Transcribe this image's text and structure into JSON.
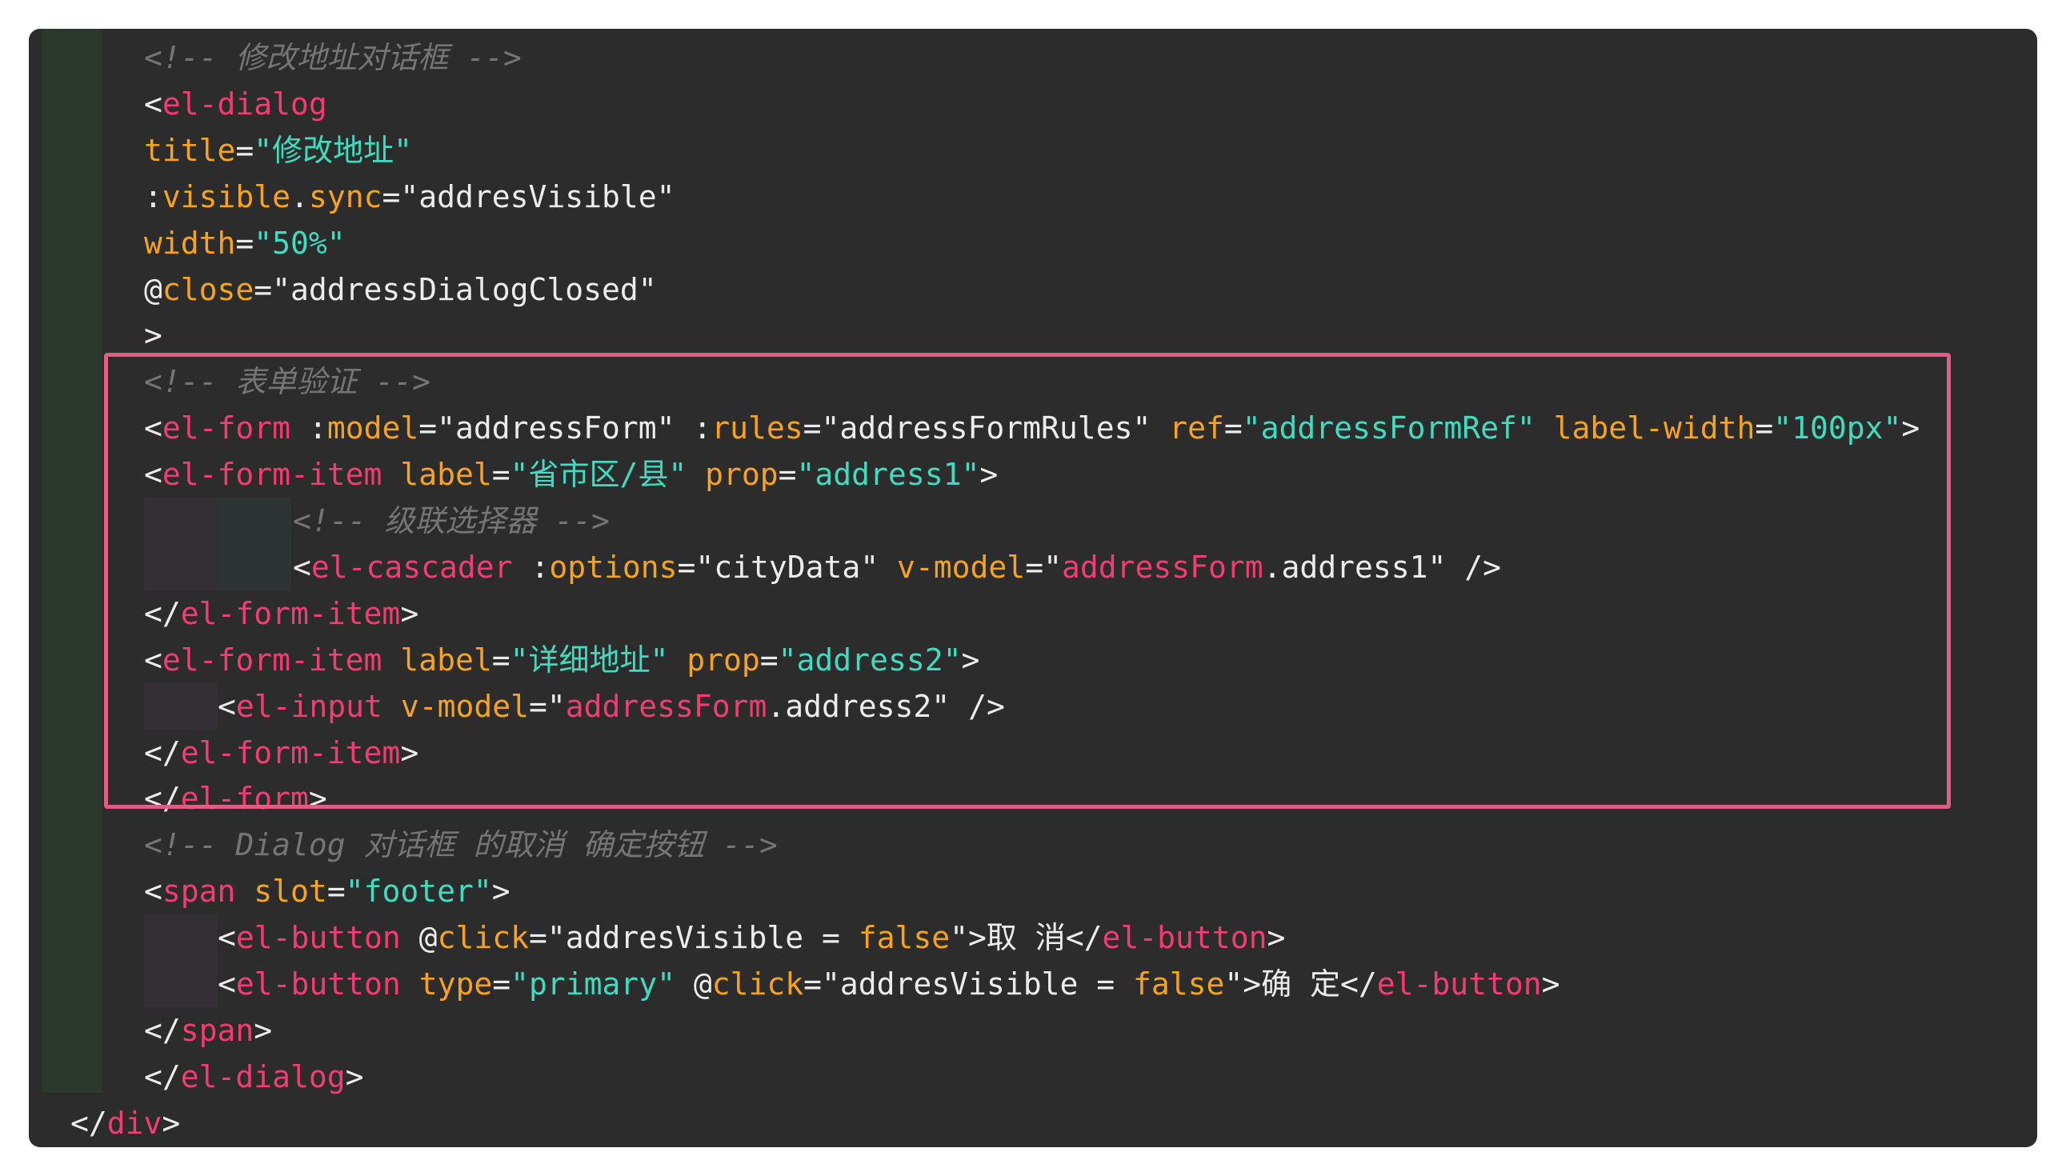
{
  "colors": {
    "background": "#2b2c2b",
    "gutter": "#2c372e",
    "comment": "#757575",
    "tag": "#f33c75",
    "attribute": "#f7a31c",
    "string": "#3fdcc0",
    "plain": "#ececec",
    "highlight_box": "#e25d83"
  },
  "lines": [
    [
      {
        "t": "<!-- 修改地址对话框 -->",
        "c": "c"
      }
    ],
    [
      {
        "t": "<",
        "c": "plain"
      },
      {
        "t": "el-dialog",
        "c": "tag"
      }
    ],
    [
      {
        "t": "title",
        "c": "attr"
      },
      {
        "t": "=",
        "c": "plain"
      },
      {
        "t": "\"修改地址\"",
        "c": "str"
      }
    ],
    [
      {
        "t": ":",
        "c": "plain"
      },
      {
        "t": "visible",
        "c": "attr"
      },
      {
        "t": ".",
        "c": "plain"
      },
      {
        "t": "sync",
        "c": "attr"
      },
      {
        "t": "=\"addresVisible\"",
        "c": "plain"
      }
    ],
    [
      {
        "t": "width",
        "c": "attr"
      },
      {
        "t": "=",
        "c": "plain"
      },
      {
        "t": "\"50%\"",
        "c": "str"
      }
    ],
    [
      {
        "t": "@",
        "c": "plain"
      },
      {
        "t": "close",
        "c": "attr"
      },
      {
        "t": "=\"addressDialogClosed\"",
        "c": "plain"
      }
    ],
    [
      {
        "t": ">",
        "c": "plain"
      }
    ],
    [
      {
        "t": "<!-- 表单验证 -->",
        "c": "c"
      }
    ],
    [
      {
        "t": "<",
        "c": "plain"
      },
      {
        "t": "el-form",
        "c": "tag"
      },
      {
        "t": " :",
        "c": "plain"
      },
      {
        "t": "model",
        "c": "attr"
      },
      {
        "t": "=\"addressForm\" :",
        "c": "plain"
      },
      {
        "t": "rules",
        "c": "attr"
      },
      {
        "t": "=\"addressFormRules\" ",
        "c": "plain"
      },
      {
        "t": "ref",
        "c": "attr"
      },
      {
        "t": "=",
        "c": "plain"
      },
      {
        "t": "\"addressFormRef\"",
        "c": "str"
      },
      {
        "t": " ",
        "c": "plain"
      },
      {
        "t": "label-width",
        "c": "attr"
      },
      {
        "t": "=",
        "c": "plain"
      },
      {
        "t": "\"100px\"",
        "c": "str"
      },
      {
        "t": ">",
        "c": "plain"
      }
    ],
    [
      {
        "t": "<",
        "c": "plain"
      },
      {
        "t": "el-form-item",
        "c": "tag"
      },
      {
        "t": " ",
        "c": "plain"
      },
      {
        "t": "label",
        "c": "attr"
      },
      {
        "t": "=",
        "c": "plain"
      },
      {
        "t": "\"省市区/县\"",
        "c": "str"
      },
      {
        "t": " ",
        "c": "plain"
      },
      {
        "t": "prop",
        "c": "attr"
      },
      {
        "t": "=",
        "c": "plain"
      },
      {
        "t": "\"address1\"",
        "c": "str"
      },
      {
        "t": ">",
        "c": "plain"
      }
    ],
    [
      {
        "t": "<!-- 级联选择器 -->",
        "c": "c"
      }
    ],
    [
      {
        "t": "<",
        "c": "plain"
      },
      {
        "t": "el-cascader",
        "c": "tag"
      },
      {
        "t": " :",
        "c": "plain"
      },
      {
        "t": "options",
        "c": "attr"
      },
      {
        "t": "=\"cityData\" ",
        "c": "plain"
      },
      {
        "t": "v-model",
        "c": "attr"
      },
      {
        "t": "=\"",
        "c": "plain"
      },
      {
        "t": "addressForm",
        "c": "tag"
      },
      {
        "t": ".address1\" />",
        "c": "plain"
      }
    ],
    [
      {
        "t": "</",
        "c": "plain"
      },
      {
        "t": "el-form-item",
        "c": "tag"
      },
      {
        "t": ">",
        "c": "plain"
      }
    ],
    [
      {
        "t": "<",
        "c": "plain"
      },
      {
        "t": "el-form-item",
        "c": "tag"
      },
      {
        "t": " ",
        "c": "plain"
      },
      {
        "t": "label",
        "c": "attr"
      },
      {
        "t": "=",
        "c": "plain"
      },
      {
        "t": "\"详细地址\"",
        "c": "str"
      },
      {
        "t": " ",
        "c": "plain"
      },
      {
        "t": "prop",
        "c": "attr"
      },
      {
        "t": "=",
        "c": "plain"
      },
      {
        "t": "\"address2\"",
        "c": "str"
      },
      {
        "t": ">",
        "c": "plain"
      }
    ],
    [
      {
        "t": "<",
        "c": "plain"
      },
      {
        "t": "el-input",
        "c": "tag"
      },
      {
        "t": " ",
        "c": "plain"
      },
      {
        "t": "v-model",
        "c": "attr"
      },
      {
        "t": "=\"",
        "c": "plain"
      },
      {
        "t": "addressForm",
        "c": "tag"
      },
      {
        "t": ".address2\" />",
        "c": "plain"
      }
    ],
    [
      {
        "t": "</",
        "c": "plain"
      },
      {
        "t": "el-form-item",
        "c": "tag"
      },
      {
        "t": ">",
        "c": "plain"
      }
    ],
    [
      {
        "t": "</",
        "c": "plain"
      },
      {
        "t": "el-form",
        "c": "tag"
      },
      {
        "t": ">",
        "c": "plain"
      }
    ],
    [
      {
        "t": "<!-- Dialog 对话框 的取消 确定按钮 -->",
        "c": "c"
      }
    ],
    [
      {
        "t": "<",
        "c": "plain"
      },
      {
        "t": "span",
        "c": "tag"
      },
      {
        "t": " ",
        "c": "plain"
      },
      {
        "t": "slot",
        "c": "attr"
      },
      {
        "t": "=",
        "c": "plain"
      },
      {
        "t": "\"footer\"",
        "c": "str"
      },
      {
        "t": ">",
        "c": "plain"
      }
    ],
    [
      {
        "t": "<",
        "c": "plain"
      },
      {
        "t": "el-button",
        "c": "tag"
      },
      {
        "t": " @",
        "c": "plain"
      },
      {
        "t": "click",
        "c": "attr"
      },
      {
        "t": "=\"addresVisible = ",
        "c": "plain"
      },
      {
        "t": "false",
        "c": "kw"
      },
      {
        "t": "\">取 消</",
        "c": "plain"
      },
      {
        "t": "el-button",
        "c": "tag"
      },
      {
        "t": ">",
        "c": "plain"
      }
    ],
    [
      {
        "t": "<",
        "c": "plain"
      },
      {
        "t": "el-button",
        "c": "tag"
      },
      {
        "t": " ",
        "c": "plain"
      },
      {
        "t": "type",
        "c": "attr"
      },
      {
        "t": "=",
        "c": "plain"
      },
      {
        "t": "\"primary\"",
        "c": "str"
      },
      {
        "t": " @",
        "c": "plain"
      },
      {
        "t": "click",
        "c": "attr"
      },
      {
        "t": "=\"addresVisible = ",
        "c": "plain"
      },
      {
        "t": "false",
        "c": "kw"
      },
      {
        "t": "\">确 定</",
        "c": "plain"
      },
      {
        "t": "el-button",
        "c": "tag"
      },
      {
        "t": ">",
        "c": "plain"
      }
    ],
    [
      {
        "t": "</",
        "c": "plain"
      },
      {
        "t": "span",
        "c": "tag"
      },
      {
        "t": ">",
        "c": "plain"
      }
    ],
    [
      {
        "t": "</",
        "c": "plain"
      },
      {
        "t": "el-dialog",
        "c": "tag"
      },
      {
        "t": ">",
        "c": "plain"
      }
    ],
    [
      {
        "t": "</",
        "c": "plain"
      },
      {
        "t": "div",
        "c": "tag"
      },
      {
        "t": ">",
        "c": "plain"
      }
    ]
  ]
}
